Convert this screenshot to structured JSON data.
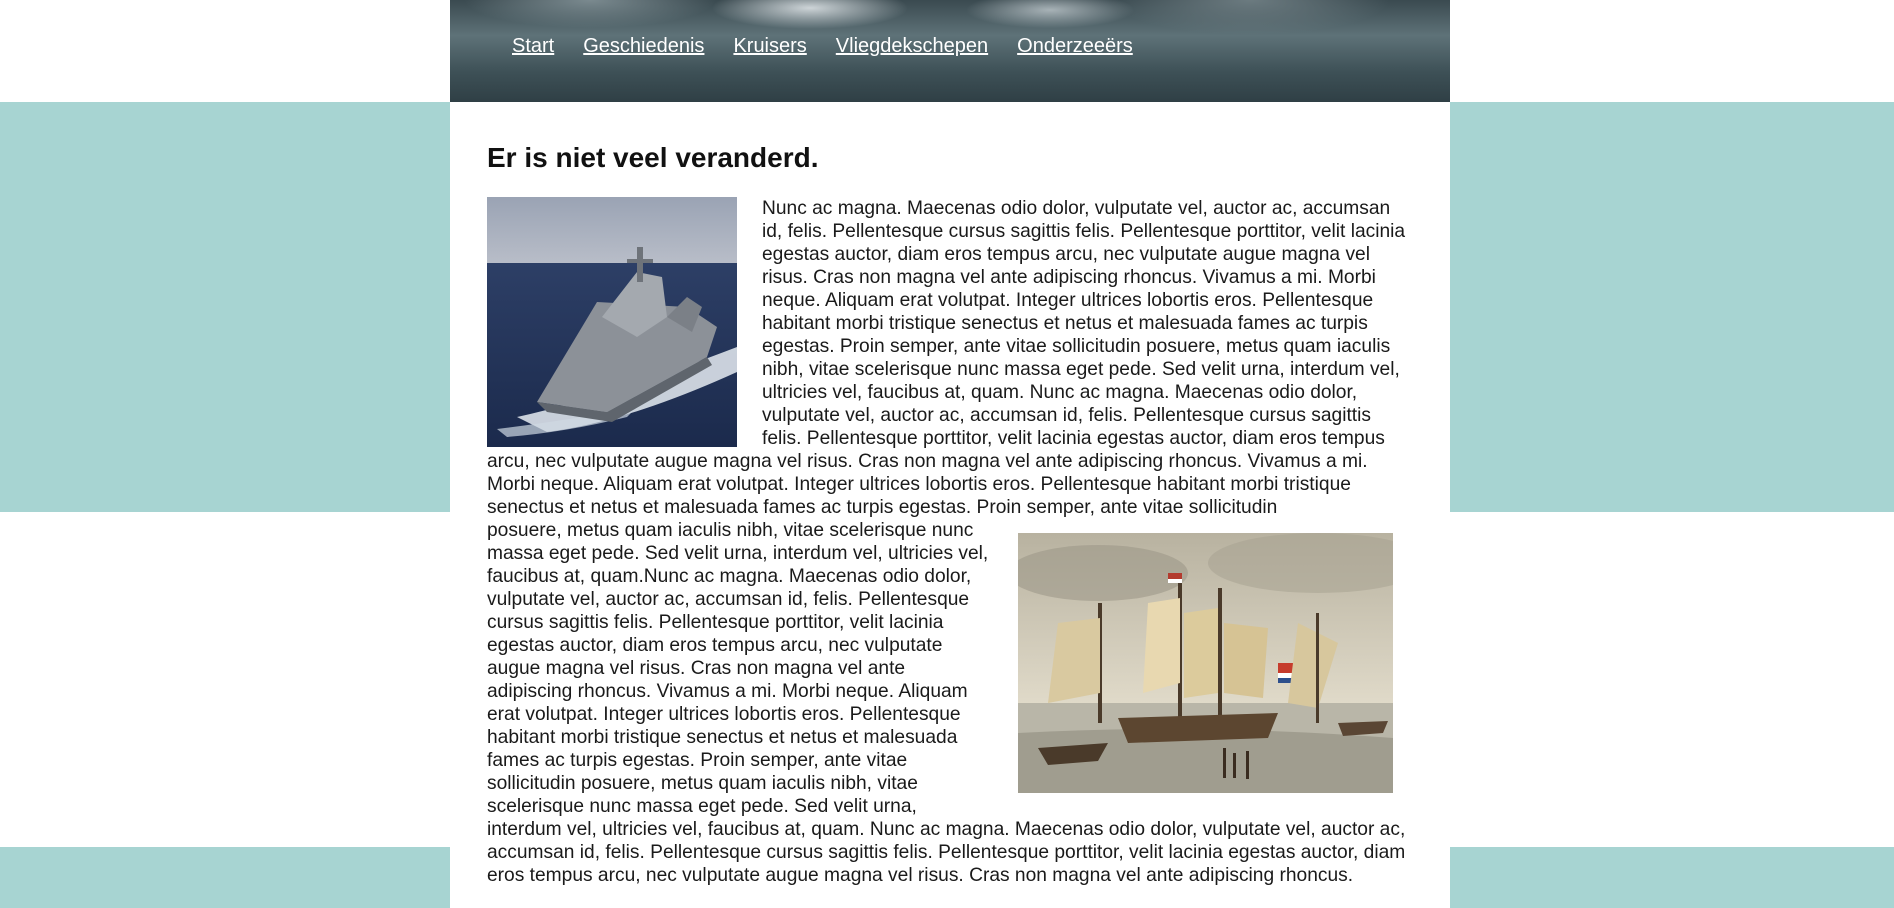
{
  "nav": {
    "items": [
      {
        "label": "Start"
      },
      {
        "label": "Geschiedenis"
      },
      {
        "label": "Kruisers"
      },
      {
        "label": "Vliegdekschepen"
      },
      {
        "label": "Onderzeeërs"
      }
    ]
  },
  "main": {
    "title": "Er is niet veel veranderd.",
    "body_part1": "Nunc ac magna. Maecenas odio dolor, vulputate vel, auctor ac, accumsan id, felis. Pellentesque cursus sagittis felis. Pellentesque porttitor, velit lacinia egestas auctor, diam eros tempus arcu, nec vulputate augue magna vel risus. Cras non magna vel ante adipiscing rhoncus. Vivamus a mi. Morbi neque. Aliquam erat volutpat. Integer ultrices lobortis eros. Pellentesque habitant morbi tristique senectus et netus et malesuada fames ac turpis egestas. Proin semper, ante vitae sollicitudin posuere, metus quam iaculis nibh, vitae scelerisque nunc massa eget pede. Sed velit urna, interdum vel, ultricies vel, faucibus at, quam. Nunc ac magna. Maecenas odio dolor, vulputate vel, auctor ac, accumsan id, felis. Pellentesque cursus sagittis felis. Pellentesque porttitor, velit lacinia egestas auctor, diam eros tempus arcu, nec vulputate augue magna vel risus. Cras non magna vel ante adipiscing rhoncus. Vivamus a mi. Morbi neque. Aliquam erat volutpat. Integer ultrices lobortis eros. Pellentesque habitant morbi tristique senectus et netus et malesuada fames ac turpis egestas. Proin semper, ante vitae sollicitudin",
    "body_part2": "posuere, metus quam iaculis nibh, vitae scelerisque nunc massa eget pede. Sed velit urna, interdum vel, ultricies vel, faucibus at, quam.Nunc ac magna. Maecenas odio dolor, vulputate vel, auctor ac, accumsan id, felis. Pellentesque cursus sagittis felis. Pellentesque porttitor, velit lacinia egestas auctor, diam eros tempus arcu, nec vulputate augue magna vel risus. Cras non magna vel ante adipiscing rhoncus. Vivamus a mi. Morbi neque. Aliquam erat volutpat. Integer ultrices lobortis eros. Pellentesque habitant morbi tristique senectus et netus et malesuada fames ac turpis egestas. Proin semper, ante vitae sollicitudin posuere, metus quam iaculis nibh, vitae scelerisque nunc massa eget pede. Sed velit urna, interdum vel, ultricies vel, faucibus at, quam. Nunc ac magna. Maecenas odio dolor, vulputate vel, auctor ac, accumsan id, felis. Pellentesque cursus sagittis felis. Pellentesque porttitor, velit lacinia egestas auctor, diam eros tempus arcu, nec vulputate augue magna vel risus. Cras non magna vel ante adipiscing rhoncus."
  },
  "colors": {
    "band": "#a7d4d2",
    "page": "#ffffff",
    "header_dark": "#3e5157",
    "text": "#1a1a1a"
  }
}
